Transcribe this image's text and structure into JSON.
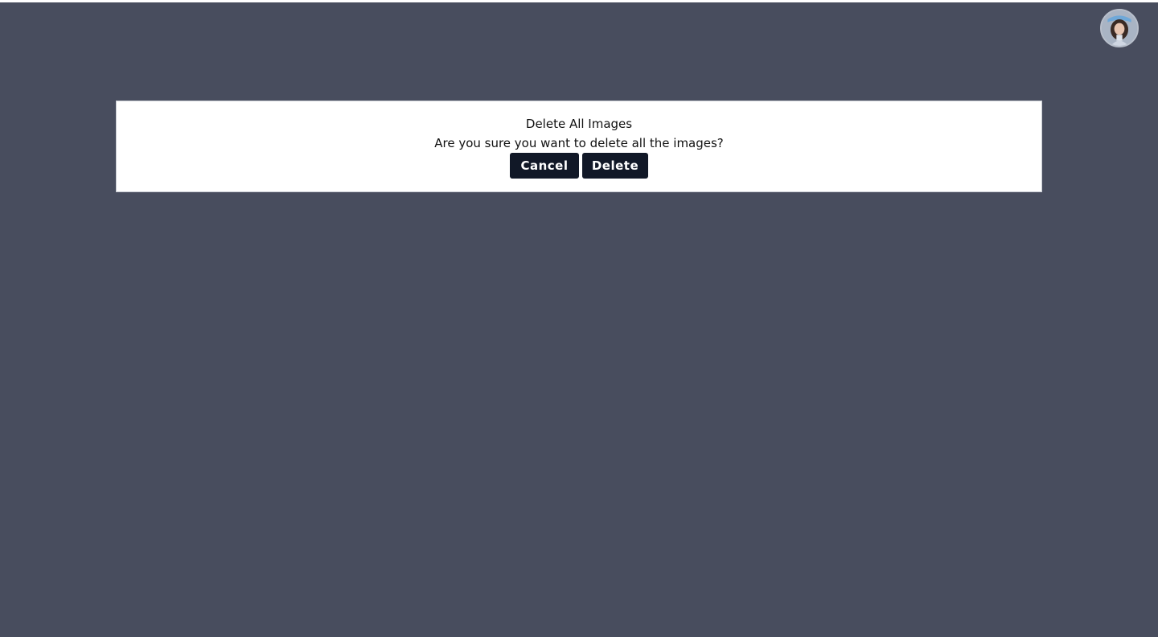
{
  "dialog": {
    "title": "Delete All Images",
    "message": "Are you sure you want to delete all the images?",
    "cancel_label": "Cancel",
    "delete_label": "Delete"
  },
  "header": {
    "avatar_icon": "user-avatar"
  },
  "colors": {
    "backdrop": "#484d5e",
    "dialog_bg": "#ffffff",
    "button_bg": "#111827",
    "button_text": "#ffffff"
  }
}
